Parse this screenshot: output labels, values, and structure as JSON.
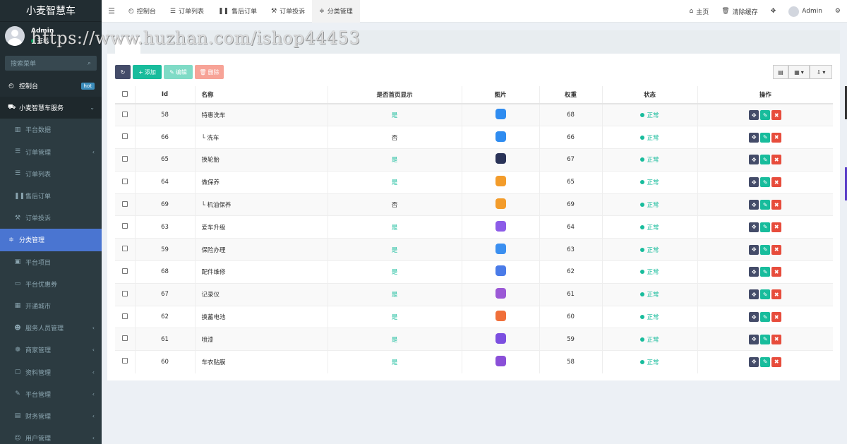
{
  "brand": "小麦智慧车",
  "user": {
    "name": "Admin",
    "status": "在线"
  },
  "sidebar": {
    "search_placeholder": "搜索菜单",
    "items": [
      {
        "label": "控制台",
        "icon": "dashboard-icon",
        "badge": "hot"
      },
      {
        "label": "小麦智慧车服务",
        "icon": "car-icon"
      },
      {
        "label": "平台数据",
        "icon": "bar-chart-icon"
      },
      {
        "label": "订单管理",
        "icon": "list-icon"
      },
      {
        "label": "订单列表",
        "icon": "list-icon"
      },
      {
        "label": "售后订单",
        "icon": "pause-icon"
      },
      {
        "label": "订单投诉",
        "icon": "gavel-icon"
      },
      {
        "label": "分类管理",
        "icon": "sliders-icon"
      },
      {
        "label": "平台项目",
        "icon": "briefcase-icon"
      },
      {
        "label": "平台优惠券",
        "icon": "credit-card-icon"
      },
      {
        "label": "开通城市",
        "icon": "map-icon"
      },
      {
        "label": "服务人员管理",
        "icon": "users-icon"
      },
      {
        "label": "商家管理",
        "icon": "paw-icon"
      },
      {
        "label": "资料管理",
        "icon": "folder-icon"
      },
      {
        "label": "平台管理",
        "icon": "wrench-icon"
      },
      {
        "label": "财务管理",
        "icon": "book-icon"
      },
      {
        "label": "用户管理",
        "icon": "user-icon"
      }
    ]
  },
  "navbar": {
    "tabs": [
      "控制台",
      "订单列表",
      "售后订单",
      "订单投诉",
      "分类管理"
    ],
    "home": "主页",
    "clear_cache": "清除缓存",
    "admin": "Admin"
  },
  "watermark": "https://www.huzhan.com/ishop44453",
  "toolbar": {
    "add": "添加",
    "edit": "编辑",
    "delete": "删除"
  },
  "table": {
    "headers": [
      "Id",
      "名称",
      "是否首页显示",
      "图片",
      "权重",
      "状态",
      "操作"
    ],
    "rows": [
      {
        "id": "58",
        "name": "特惠洗车",
        "home": "是",
        "weight": "68",
        "status": "正常",
        "pic_color": "#2f8cf0"
      },
      {
        "id": "66",
        "name": "└ 洗车",
        "home": "否",
        "weight": "66",
        "status": "正常",
        "pic_color": "#2f8cf0"
      },
      {
        "id": "65",
        "name": "换轮胎",
        "home": "是",
        "weight": "67",
        "status": "正常",
        "pic_color": "#2a3358"
      },
      {
        "id": "64",
        "name": "做保养",
        "home": "是",
        "weight": "65",
        "status": "正常",
        "pic_color": "#f39c2b"
      },
      {
        "id": "69",
        "name": "└ 机油保养",
        "home": "否",
        "weight": "69",
        "status": "正常",
        "pic_color": "#f39c2b"
      },
      {
        "id": "63",
        "name": "爱车升级",
        "home": "是",
        "weight": "64",
        "status": "正常",
        "pic_color": "#8c5ce8"
      },
      {
        "id": "59",
        "name": "保险办理",
        "home": "是",
        "weight": "63",
        "status": "正常",
        "pic_color": "#3b8ff0"
      },
      {
        "id": "68",
        "name": "配件维修",
        "home": "是",
        "weight": "62",
        "status": "正常",
        "pic_color": "#4a7be8"
      },
      {
        "id": "67",
        "name": "记录仪",
        "home": "是",
        "weight": "61",
        "status": "正常",
        "pic_color": "#9b59d6"
      },
      {
        "id": "62",
        "name": "换蓄电池",
        "home": "是",
        "weight": "60",
        "status": "正常",
        "pic_color": "#f06f3a"
      },
      {
        "id": "61",
        "name": "喷漆",
        "home": "是",
        "weight": "59",
        "status": "正常",
        "pic_color": "#7c4fe0"
      },
      {
        "id": "60",
        "name": "车衣贴膜",
        "home": "是",
        "weight": "58",
        "status": "正常",
        "pic_color": "#8a4fd8"
      }
    ]
  }
}
